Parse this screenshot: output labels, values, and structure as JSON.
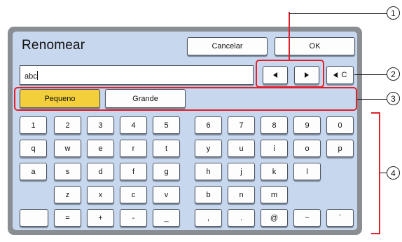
{
  "dialog": {
    "title": "Renomear",
    "cancel_label": "Cancelar",
    "ok_label": "OK"
  },
  "name_field": {
    "value": "abc"
  },
  "cursor_controls": {
    "left_icon": "triangle-left-icon",
    "right_icon": "triangle-right-icon"
  },
  "backspace": {
    "label": "C"
  },
  "size_toggle": {
    "small_label": "Pequeno",
    "large_label": "Grande",
    "selected": "Pequeno",
    "selected_color": "#f2cf3b"
  },
  "keyboard": {
    "row1": [
      "1",
      "2",
      "3",
      "4",
      "5",
      "6",
      "7",
      "8",
      "9",
      "0"
    ],
    "row2": [
      "q",
      "w",
      "e",
      "r",
      "t",
      "y",
      "u",
      "i",
      "o",
      "p"
    ],
    "row3": [
      "a",
      "s",
      "d",
      "f",
      "g",
      "h",
      "j",
      "k",
      "l"
    ],
    "row4": [
      "z",
      "x",
      "c",
      "v",
      "b",
      "n",
      "m"
    ],
    "row5": [
      "",
      "=",
      "+",
      "-",
      "_",
      ",",
      ".",
      "@",
      "~",
      "`"
    ]
  },
  "callouts": [
    "1",
    "2",
    "3",
    "4"
  ],
  "colors": {
    "panel_bg": "#c7d7ee",
    "frame": "#8a8e93",
    "callout_red": "#e0212c"
  }
}
